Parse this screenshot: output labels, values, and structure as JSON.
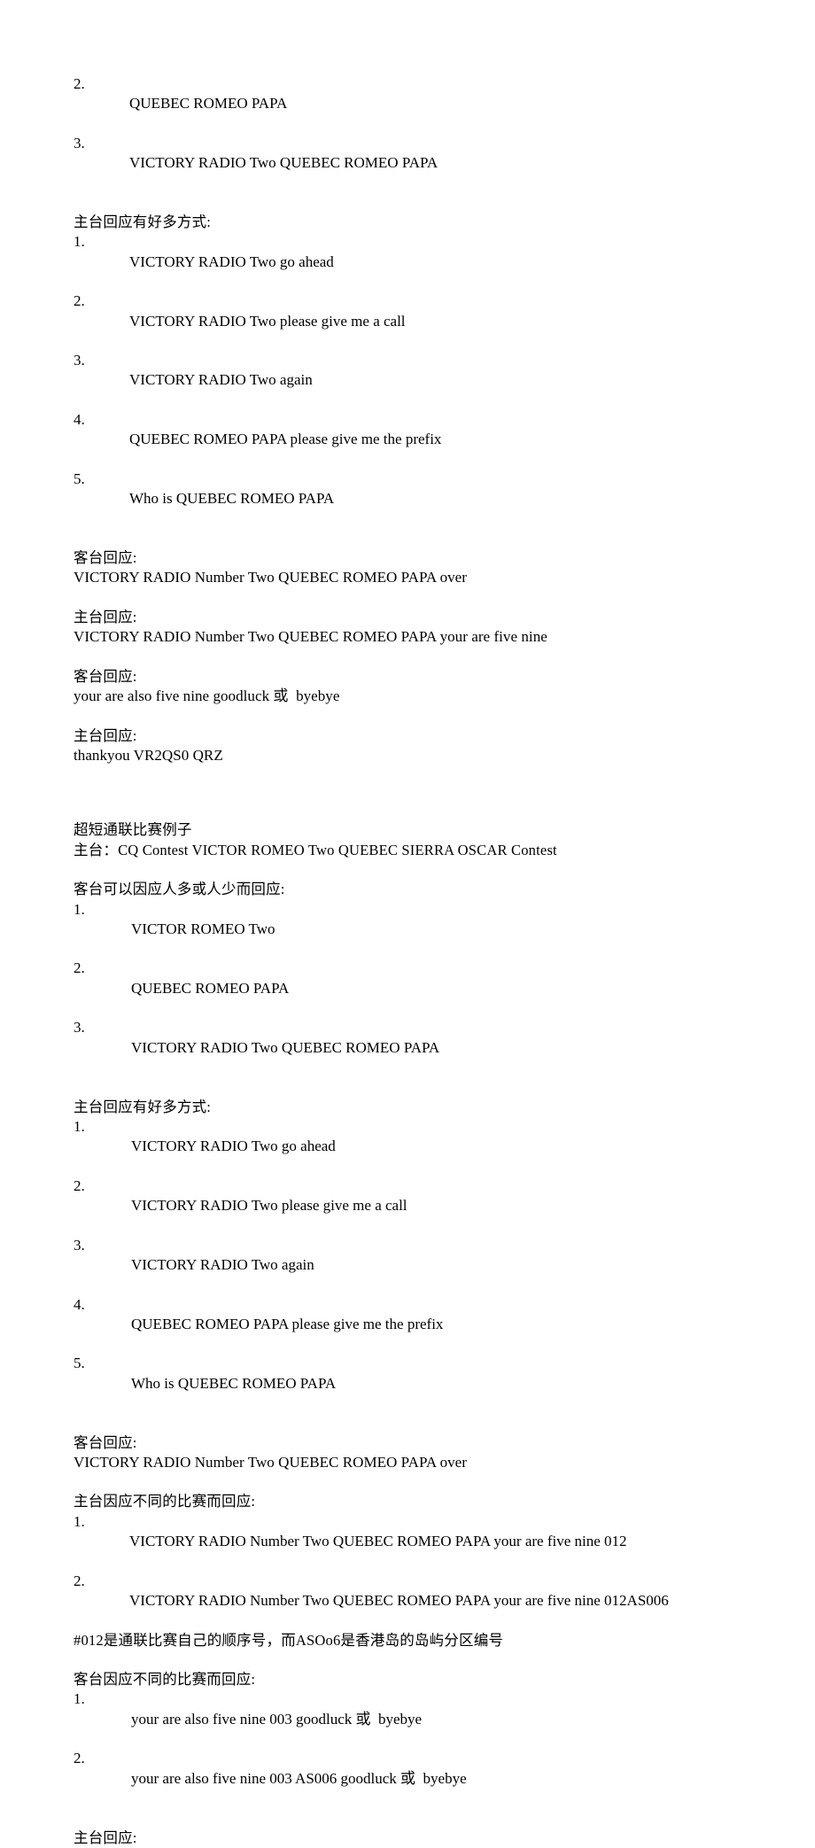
{
  "document": {
    "page_background": "#ffffff",
    "text_color": "#000000",
    "blocks": [
      {
        "id": "intro-list-tail",
        "type": "ordered-list",
        "items": [
          {
            "num": "2.",
            "text": "QUEBEC ROMEO PAPA"
          },
          {
            "num": "3.",
            "text": "VICTORY RADIO Two QUEBEC ROMEO PAPA"
          }
        ]
      },
      {
        "id": "main-station-ways-1",
        "type": "heading-list",
        "heading": "主台回应有好多方式:",
        "items": [
          {
            "num": "1.",
            "text": "VICTORY RADIO Two go ahead"
          },
          {
            "num": "2.",
            "text": "VICTORY RADIO Two please give me a call"
          },
          {
            "num": "3.",
            "text": "VICTORY RADIO Two again"
          },
          {
            "num": "4.",
            "text": "QUEBEC ROMEO PAPA please give me the prefix"
          },
          {
            "num": "5.",
            "text": "Who is QUEBEC ROMEO PAPA"
          }
        ]
      },
      {
        "id": "guest-reply-1",
        "type": "heading-text",
        "heading": "客台回应:",
        "lines": [
          "VICTORY RADIO Number Two QUEBEC ROMEO PAPA over"
        ]
      },
      {
        "id": "main-reply-1",
        "type": "heading-text",
        "heading": "主台回应:",
        "lines": [
          "VICTORY RADIO Number Two QUEBEC ROMEO PAPA your are five nine"
        ]
      },
      {
        "id": "guest-reply-2",
        "type": "heading-text",
        "heading": "客台回应:",
        "lines": [
          "your are also five nine goodluck 或  byebye"
        ]
      },
      {
        "id": "main-reply-2",
        "type": "heading-text",
        "heading": "主台回应:",
        "lines": [
          "thankyou VR2QS0 QRZ"
        ]
      },
      {
        "id": "contest-example",
        "type": "heading-text",
        "heading": "超短通联比赛例子",
        "lines": [
          "主台：CQ Contest VICTOR ROMEO Two QUEBEC SIERRA OSCAR Contest"
        ]
      },
      {
        "id": "guest-crowd-list",
        "type": "heading-list",
        "heading": "客台可以因应人多或人少而回应:",
        "items": [
          {
            "num": "1.",
            "text": "VICTOR ROMEO Two"
          },
          {
            "num": "2.",
            "text": "QUEBEC ROMEO PAPA"
          },
          {
            "num": "3.",
            "text": "VICTORY RADIO Two QUEBEC ROMEO PAPA"
          }
        ]
      },
      {
        "id": "main-station-ways-2",
        "type": "heading-list",
        "heading": "主台回应有好多方式:",
        "items": [
          {
            "num": "1.",
            "text": "VICTORY RADIO Two go ahead"
          },
          {
            "num": "2.",
            "text": "VICTORY RADIO Two please give me a call"
          },
          {
            "num": "3.",
            "text": "VICTORY RADIO Two again"
          },
          {
            "num": "4.",
            "text": "QUEBEC ROMEO PAPA please give me the prefix"
          },
          {
            "num": "5.",
            "text": "Who is QUEBEC ROMEO PAPA"
          }
        ]
      },
      {
        "id": "guest-reply-3",
        "type": "heading-text",
        "heading": "客台回应:",
        "lines": [
          "VICTORY RADIO Number Two QUEBEC ROMEO PAPA over"
        ]
      },
      {
        "id": "main-contest-replies",
        "type": "heading-list-note",
        "heading": "主台因应不同的比赛而回应:",
        "items": [
          {
            "num": "1.",
            "text": "VICTORY RADIO Number Two QUEBEC ROMEO PAPA your are five nine 012"
          },
          {
            "num": "2.",
            "text": "VICTORY RADIO Number Two QUEBEC ROMEO PAPA your are five nine 012AS006"
          }
        ],
        "note": "#012是通联比赛自己的顺序号，而ASOo6是香港岛的岛屿分区编号"
      },
      {
        "id": "guest-contest-replies",
        "type": "heading-list",
        "heading": "客台因应不同的比赛而回应:",
        "items": [
          {
            "num": "1.",
            "text": "your are also five nine 003 goodluck 或  byebye"
          },
          {
            "num": "2.",
            "text": "your are also five nine 003 AS006 goodluck 或  byebye"
          }
        ]
      },
      {
        "id": "main-reply-final",
        "type": "heading-text",
        "heading": "主台回应:",
        "lines": []
      }
    ]
  }
}
